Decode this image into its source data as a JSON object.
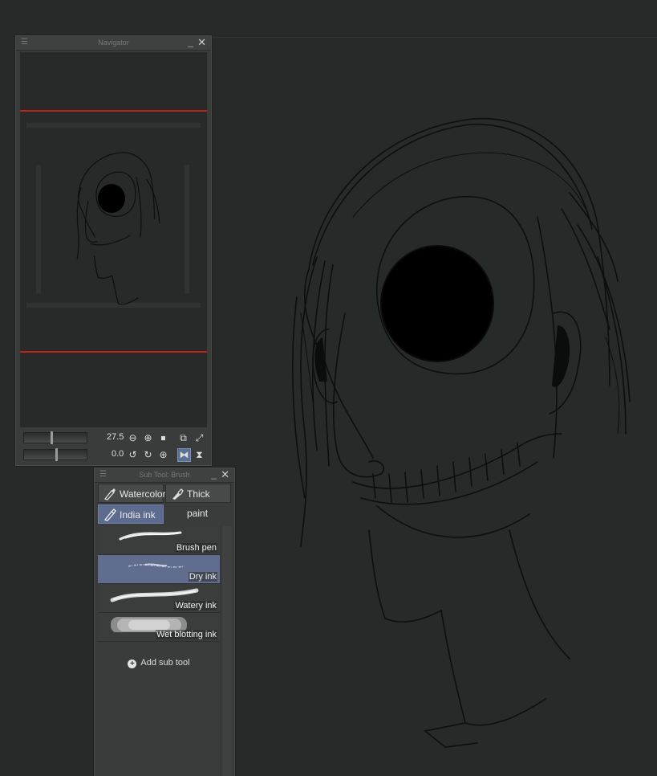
{
  "navigator": {
    "title": "Navigator",
    "zoom_value": "27.5",
    "rotate_value": "0.0",
    "zoom_slider_fraction": 0.42,
    "rotate_slider_fraction": 0.5
  },
  "subtool": {
    "title": "Sub Tool: Brush",
    "tabs": [
      {
        "label": "Watercolor"
      },
      {
        "label": "Thick paint"
      },
      {
        "label": "India ink"
      }
    ],
    "items": [
      {
        "label": "Brush pen"
      },
      {
        "label": "Dry ink"
      },
      {
        "label": "Watery ink"
      },
      {
        "label": "Wet blotting ink"
      }
    ],
    "add_label": "Add sub tool"
  },
  "colors": {
    "canvas": "#262a29",
    "selection": "#606d8e",
    "nav_frame": "#c0211d"
  }
}
